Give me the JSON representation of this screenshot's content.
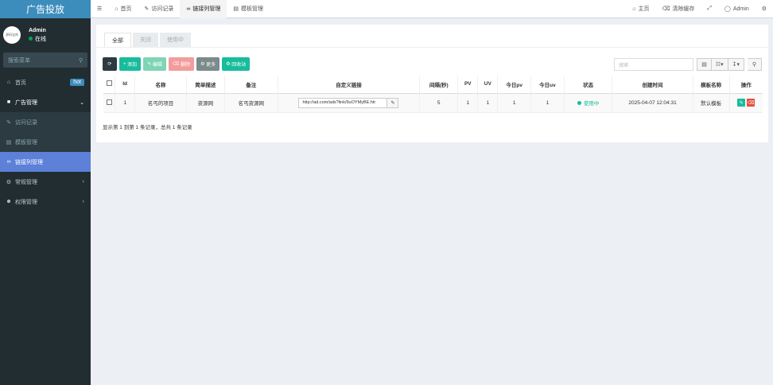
{
  "sidebar": {
    "logo": "广告投放",
    "avatar_text": "源码宝库",
    "user_name": "Admin",
    "user_status": "在线",
    "search_placeholder": "搜索菜单",
    "items": [
      {
        "label": "首页",
        "icon": "home-icon",
        "badge": "hot"
      },
      {
        "label": "广告管理",
        "icon": "ad-icon"
      },
      {
        "label": "访问记录",
        "icon": "edit-icon"
      },
      {
        "label": "模板管理",
        "icon": "template-icon"
      },
      {
        "label": "链接列管理",
        "icon": "link-icon"
      },
      {
        "label": "常规管理",
        "icon": "cogs-icon"
      },
      {
        "label": "权限管理",
        "icon": "users-icon"
      }
    ]
  },
  "topbar": {
    "tabs": [
      "首页",
      "访问记录",
      "链接列管理",
      "模板管理"
    ],
    "right": [
      "主页",
      "清除缓存",
      "Admin"
    ]
  },
  "tabs": [
    "全部",
    "关闭",
    "使用中"
  ],
  "toolbar": {
    "add": "添加",
    "edit": "编辑",
    "delete": "删除",
    "more": "更多",
    "recycle": "回收站",
    "search_placeholder": "搜索"
  },
  "table": {
    "headers": [
      "Id",
      "名称",
      "简单描述",
      "备注",
      "自定义链接",
      "间隔(秒)",
      "PV",
      "UV",
      "今日pv",
      "今日uv",
      "状态",
      "创建时间",
      "模板名称",
      "操作"
    ],
    "rows": [
      {
        "id": "1",
        "name": "名丐的项目",
        "desc": "资源网",
        "remark": "名丐资源网",
        "link": "http://ad.com/ads?link/9uOYMyBE.htr",
        "interval": "5",
        "pv": "1",
        "uv": "1",
        "today_pv": "1",
        "today_uv": "1",
        "status": "使用中",
        "created": "2025-04-07 12:04:31",
        "template": "默认模板"
      }
    ]
  },
  "page_info": "显示第 1 到第 1 条记录，总共 1 条记录",
  "colors": {
    "accent": "#18bc9c",
    "sidebar": "#222d32",
    "active_menu": "#5d80d8",
    "danger": "#e74c3c"
  }
}
